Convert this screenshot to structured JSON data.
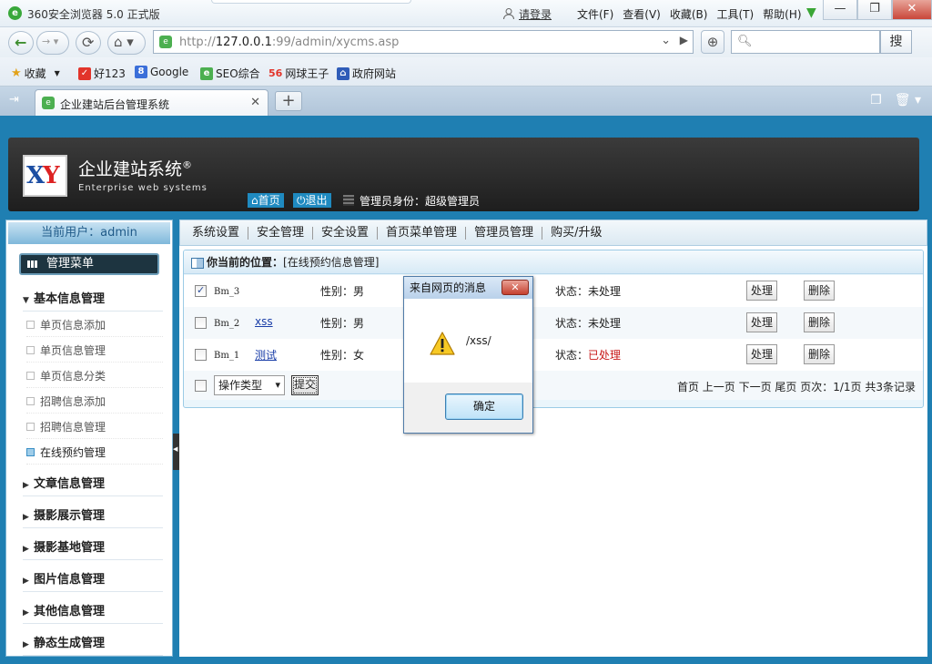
{
  "browser": {
    "window_title": "360安全浏览器 5.0 正式版",
    "login": "请登录",
    "menu": [
      "文件(F)",
      "查看(V)",
      "收藏(B)",
      "工具(T)",
      "帮助(H)"
    ],
    "win_min": "—",
    "win_max": "❐",
    "win_close": "✕",
    "url_prefix": "http://",
    "url_host": "127.0.0.1",
    "url_rest": ":99/admin/xycms.asp",
    "search_button": "搜",
    "favorites": [
      {
        "label": "收藏",
        "icon": "star-icon"
      },
      {
        "label": "好123",
        "icon": "hao123-icon"
      },
      {
        "label": "Google",
        "icon": "google-icon"
      },
      {
        "label": "SEO综合",
        "icon": "seo-icon"
      },
      {
        "label": "网球王子",
        "icon": "56-icon",
        "badge": "56"
      },
      {
        "label": "政府网站",
        "icon": "gov-icon"
      }
    ],
    "tab_title": "企业建站后台管理系统",
    "new_tab": "+"
  },
  "header": {
    "brand_cn": "企业建站系统",
    "registered": "®",
    "brand_en": "Enterprise web systems",
    "home_btn": "首页",
    "logout_btn": "退出",
    "role": "管理员身份：超级管理员"
  },
  "sidebar": {
    "current_user": "当前用户：admin",
    "menu_title": "管理菜单",
    "groups": [
      {
        "label": "基本信息管理",
        "expanded": true,
        "items": [
          "单页信息添加",
          "单页信息管理",
          "单页信息分类",
          "招聘信息添加",
          "招聘信息管理",
          "在线预约管理"
        ],
        "active_item": "在线预约管理"
      },
      {
        "label": "文章信息管理"
      },
      {
        "label": "摄影展示管理"
      },
      {
        "label": "摄影基地管理"
      },
      {
        "label": "图片信息管理"
      },
      {
        "label": "其他信息管理"
      },
      {
        "label": "静态生成管理"
      }
    ]
  },
  "topnav": [
    "系统设置",
    "安全管理",
    "安全设置",
    "首页菜单管理",
    "管理员管理",
    "购买/升级"
  ],
  "panel": {
    "location_label": "你当前的位置：",
    "location_value": "[在线预约信息管理]",
    "rows": [
      {
        "id": "Bm_3",
        "name": "",
        "sex": "性别：男",
        "status_label": "状态：",
        "status": "未处理",
        "processed": false,
        "checked": true
      },
      {
        "id": "Bm_2",
        "name": "xss",
        "sex": "性别：男",
        "status_label": "状态：",
        "status": "未处理",
        "processed": false,
        "checked": false
      },
      {
        "id": "Bm_1",
        "name": "测试",
        "sex": "性别：女",
        "status_label": "状态：",
        "status": "已处理",
        "processed": true,
        "checked": false
      }
    ],
    "process_btn": "处理",
    "delete_btn": "删除",
    "op_select": "操作类型",
    "submit_btn": "提交",
    "pager": "首页 上一页 下一页 尾页 页次：1/1页 共3条记录"
  },
  "dialog": {
    "title": "来自网页的消息",
    "message": "/xss/",
    "ok": "确定",
    "close": "✕"
  },
  "colors": {
    "accent": "#1f7fb2",
    "status_done": "#c81818"
  }
}
